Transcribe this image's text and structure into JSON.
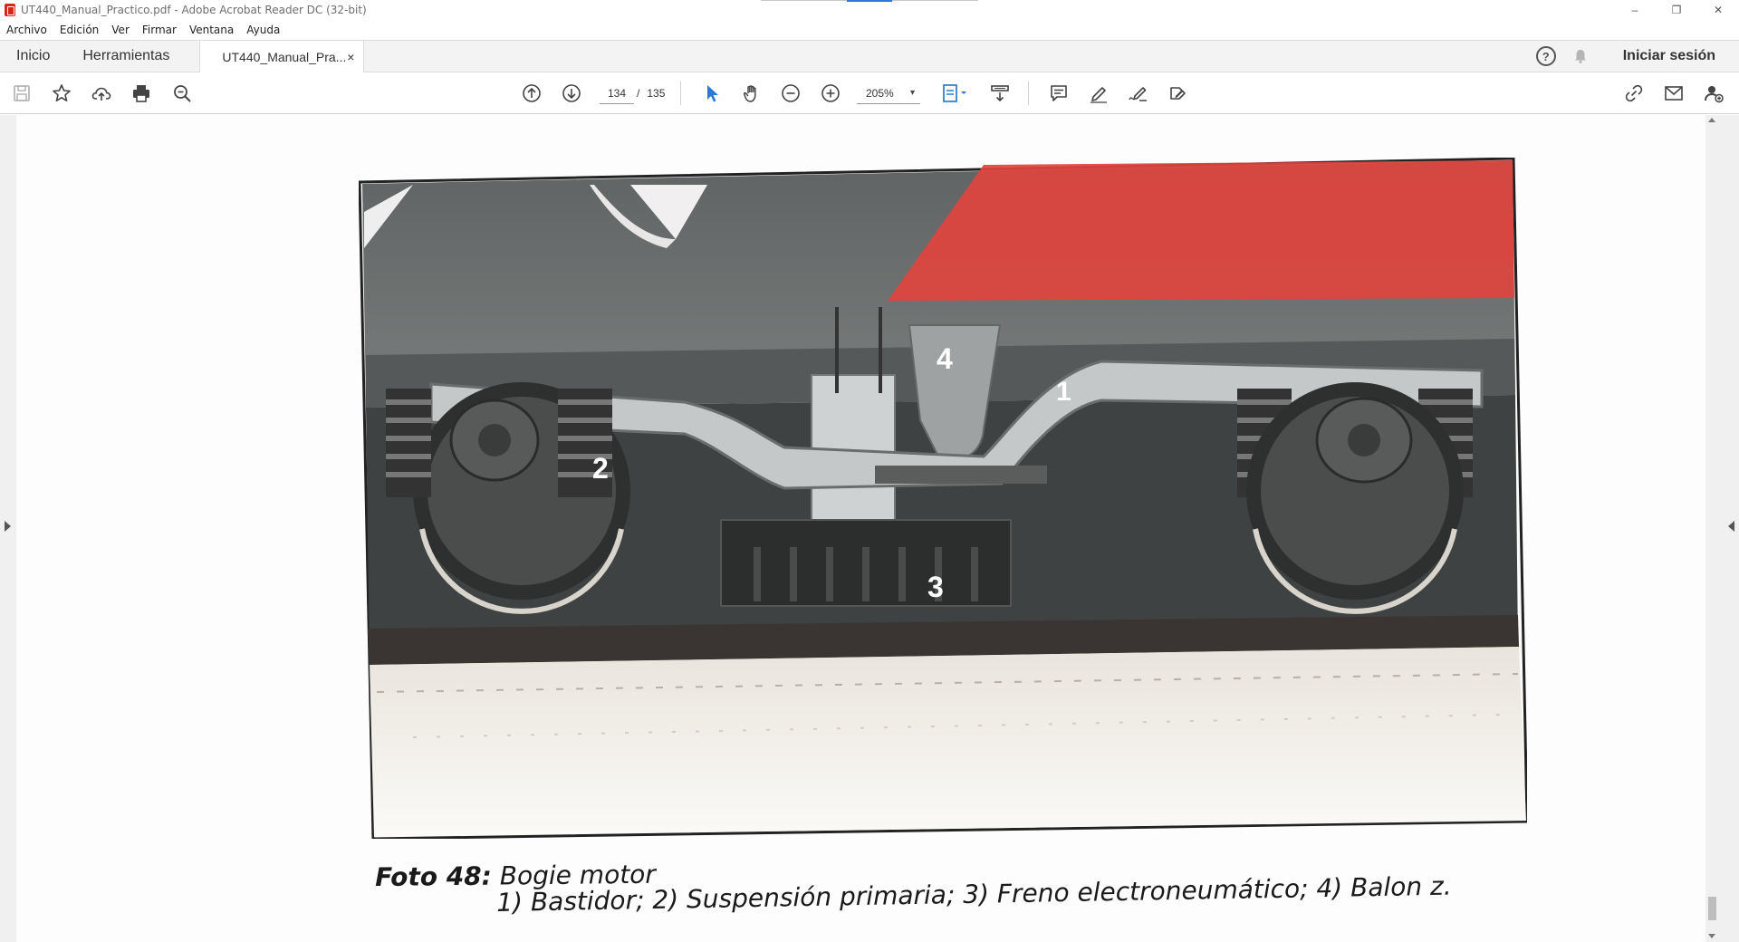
{
  "window": {
    "title": "UT440_Manual_Practico.pdf - Adobe Acrobat Reader DC (32-bit)",
    "controls": [
      "–",
      "❐",
      "✕"
    ]
  },
  "menu": [
    "Archivo",
    "Edición",
    "Ver",
    "Firmar",
    "Ventana",
    "Ayuda"
  ],
  "tabs": {
    "home": "Inicio",
    "tools": "Herramientas",
    "document": "UT440_Manual_Pra...",
    "close": "×"
  },
  "account": {
    "signin": "Iniciar sesión",
    "help": "?"
  },
  "toolbar": {
    "current_page": "134",
    "separator": "/",
    "total_pages": "135",
    "zoom": "205%",
    "zoom_caret": "▾"
  },
  "document": {
    "photo_labels": [
      "1",
      "2",
      "3",
      "4"
    ],
    "caption_lead": "Foto 48:",
    "caption_title": "Bogie motor",
    "caption_items": "1) Bastidor; 2) Suspensión primaria; 3) Freno electroneumático; 4) Balon z."
  },
  "colors": {
    "accent": "#2a7ad5",
    "locomotive_red": "#e0443e",
    "body_gray": "#6f7272"
  }
}
